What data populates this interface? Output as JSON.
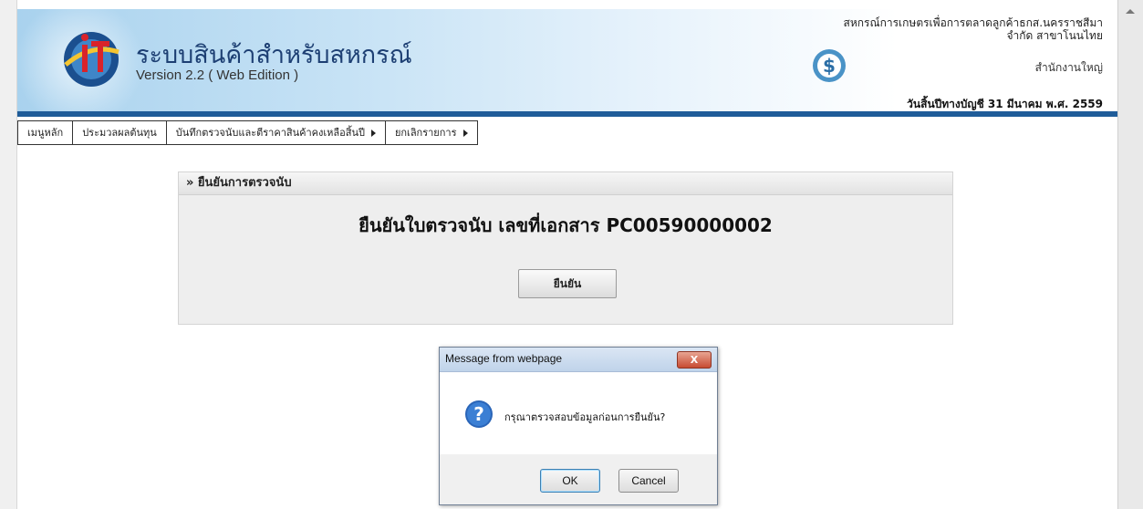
{
  "header": {
    "title": "ระบบสินค้าสำหรับสหกรณ์",
    "version": "Version 2.2 ( Web Edition )",
    "org_line1": "สหกรณ์การเกษตรเพื่อการตลาดลูกค้าธกส.นครราชสีมา",
    "org_line2": "จำกัด สาขาโนนไทย",
    "branch": "สำนักงานใหญ่",
    "fiscal_year": "วันสิ้นปีทางบัญชี 31 มีนาคม พ.ศ. 2559",
    "logo_icon": "it-logo-icon",
    "dollar_icon": "dollar-icon"
  },
  "menu": [
    {
      "label": "เมนูหลัก",
      "has_submenu": false
    },
    {
      "label": "ประมวลผลต้นทุน",
      "has_submenu": false
    },
    {
      "label": "บันทึกตรวจนับและตีราคาสินค้าคงเหลือสิ้นปี",
      "has_submenu": true
    },
    {
      "label": "ยกเลิกรายการ",
      "has_submenu": true
    }
  ],
  "panel": {
    "title": "» ยืนยันการตรวจนับ",
    "message": "ยืนยันใบตรวจนับ เลขที่เอกสาร PC00590000002",
    "confirm_label": "ยืนยัน"
  },
  "dialog": {
    "title": "Message from webpage",
    "close_label": "X",
    "message": "กรุณาตรวจสอบข้อมูลก่อนการยืนยัน?",
    "ok_label": "OK",
    "cancel_label": "Cancel",
    "icon": "question-icon"
  },
  "colors": {
    "header_bar": "#1f5c99",
    "title_text": "#1d3f73",
    "close_button": "#c74b32"
  }
}
